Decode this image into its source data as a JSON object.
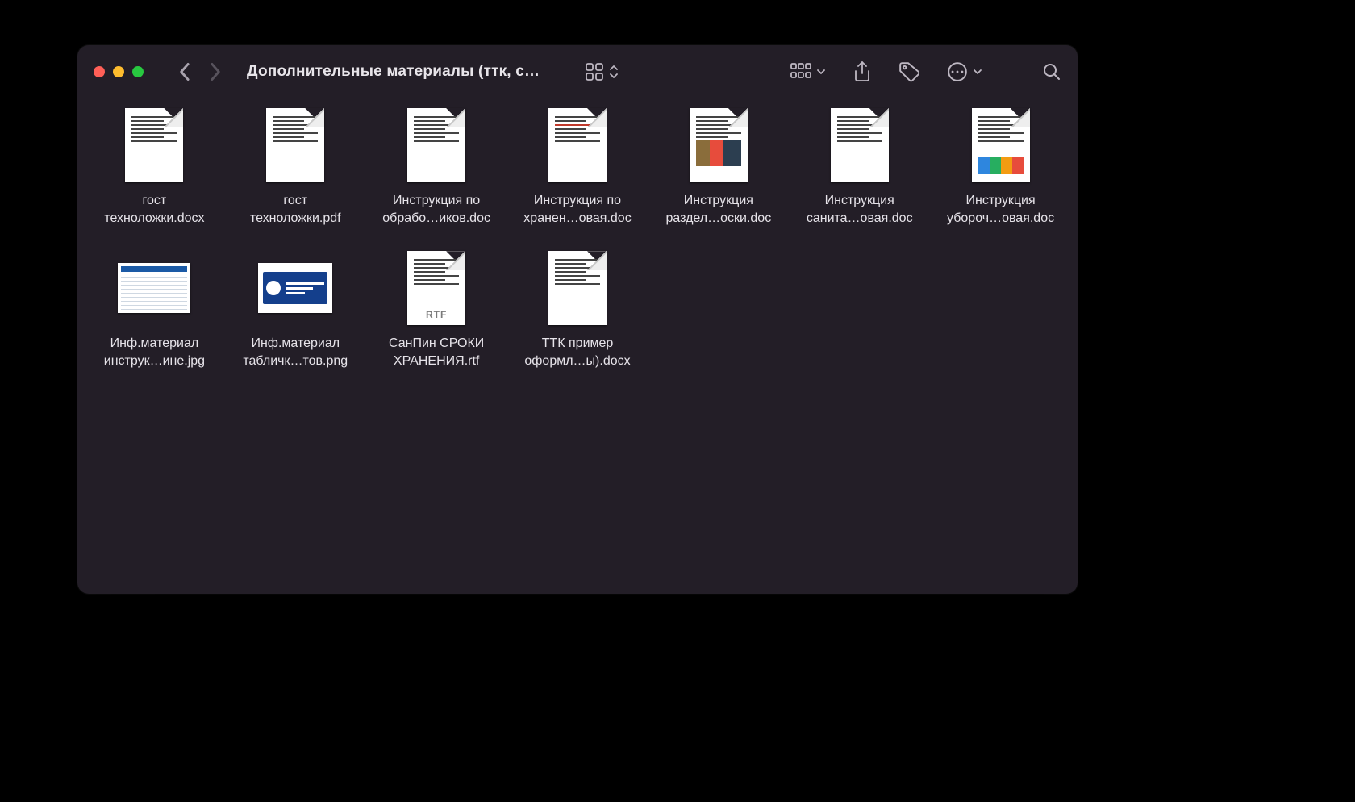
{
  "window": {
    "title": "Дополнительные материалы (ттк, с…"
  },
  "files": [
    {
      "line1": "гост",
      "line2": "техноложки.docx",
      "kind": "doc"
    },
    {
      "line1": "гост",
      "line2": "техноложки.pdf",
      "kind": "doc"
    },
    {
      "line1": "Инструкция по",
      "line2": "обрабо…иков.doc",
      "kind": "doc"
    },
    {
      "line1": "Инструкция по",
      "line2": "хранен…овая.doc",
      "kind": "docr"
    },
    {
      "line1": "Инструкция",
      "line2": "раздел…оски.doc",
      "kind": "docimg"
    },
    {
      "line1": "Инструкция",
      "line2": "санита…овая.doc",
      "kind": "doc"
    },
    {
      "line1": "Инструкция",
      "line2": "убороч…овая.doc",
      "kind": "docchart"
    },
    {
      "line1": "Инф.материал",
      "line2": "инструк…ине.jpg",
      "kind": "jpg"
    },
    {
      "line1": "Инф.материал",
      "line2": "табличк…тов.png",
      "kind": "png"
    },
    {
      "line1": "СанПин СРОКИ",
      "line2": "ХРАНЕНИЯ.rtf",
      "kind": "rtf"
    },
    {
      "line1": "ТТК пример",
      "line2": "оформл…ы).docx",
      "kind": "doc"
    }
  ]
}
